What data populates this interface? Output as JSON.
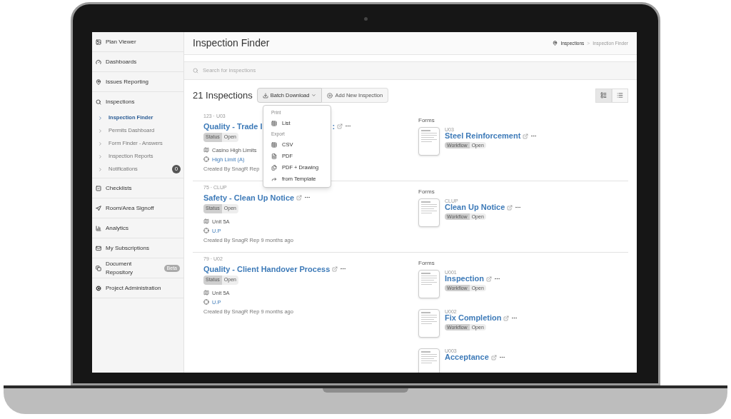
{
  "sidebar": {
    "items": [
      {
        "label": "Plan Viewer"
      },
      {
        "label": "Dashboards"
      },
      {
        "label": "Issues Reporting"
      },
      {
        "label": "Inspections",
        "children": [
          {
            "label": "Inspection Finder",
            "selected": true
          },
          {
            "label": "Permits Dashboard",
            "selected": false
          },
          {
            "label": "Form Finder - Answers",
            "selected": false
          },
          {
            "label": "Inspection Reports",
            "selected": false
          },
          {
            "label": "Notifications",
            "selected": false,
            "badge": "0"
          }
        ]
      },
      {
        "label": "Checklists"
      },
      {
        "label": "Room/Area Signoff"
      },
      {
        "label": "Analytics"
      },
      {
        "label": "My Subscriptions"
      },
      {
        "label": "Document Repository",
        "badge": "Beta"
      },
      {
        "label": "Project Administration"
      }
    ]
  },
  "header": {
    "title": "Inspection Finder",
    "breadcrumb": [
      "Inspections",
      "Inspection Finder"
    ],
    "separator": ">"
  },
  "search": {
    "placeholder": "Search for inspections"
  },
  "toolbar": {
    "count": "21 Inspections",
    "batch_button": "Batch Download",
    "add_button": "Add New Inspection",
    "views": [
      {
        "selected": true
      },
      {
        "selected": false
      }
    ]
  },
  "dropdown": {
    "open": true,
    "groups": [
      {
        "heading": "Print",
        "items": [
          "List"
        ]
      },
      {
        "heading": "Export",
        "items": [
          "CSV",
          "PDF",
          "PDF + Drawing",
          "from Template"
        ]
      }
    ]
  },
  "inspections": [
    {
      "code": "123 · U03",
      "title": "Quality - Trade I",
      "title_after": ":",
      "status_label": "Status",
      "status": "Open",
      "location": "Casino High Limits",
      "area": "High Limit (A)",
      "created": "Created By SnagR Rep",
      "forms_heading": "Forms",
      "forms": [
        {
          "code": "U03",
          "title": "Steel Reinforcement",
          "tag_label": "Workflow",
          "tag": "Open"
        }
      ]
    },
    {
      "code": "75 · CLUP",
      "title": "Safety - Clean Up Notice",
      "status_label": "Status",
      "status": "Open",
      "location": "Unit 5A",
      "area": "U.P",
      "created": "Created By SnagR Rep 9 months ago",
      "forms_heading": "Forms",
      "forms": [
        {
          "code": "CLUP",
          "title": "Clean Up Notice",
          "tag_label": "Workflow",
          "tag": "Open"
        }
      ]
    },
    {
      "code": "79 · U02",
      "title": "Quality - Client Handover Process",
      "status_label": "Status",
      "status": "Open",
      "location": "Unit 5A",
      "area": "U.P",
      "created": "Created By SnagR Rep 9 months ago",
      "forms_heading": "Forms",
      "forms": [
        {
          "code": "U001",
          "title": "Inspection",
          "tag_label": "Workflow",
          "tag": "Open"
        },
        {
          "code": "U002",
          "title": "Fix Completion",
          "tag_label": "Workflow",
          "tag": "Open"
        },
        {
          "code": "U003",
          "title": "Acceptance"
        }
      ]
    }
  ]
}
